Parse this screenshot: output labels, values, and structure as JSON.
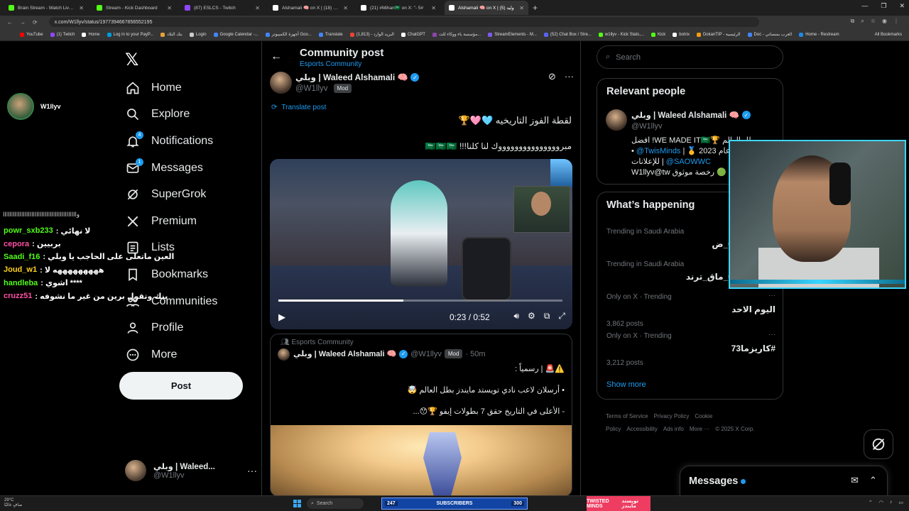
{
  "browser": {
    "tabs": [
      {
        "label": "Brain Stream - Watch Live on K",
        "color": "#53fc18",
        "active": false
      },
      {
        "label": "Stream - Kick Dashboard",
        "color": "#53fc18",
        "active": false
      },
      {
        "label": "(87) ESLCS - Twitch",
        "color": "#9146ff",
        "active": false
      },
      {
        "label": "Alshamali 🧠 on X | وليد (18)",
        "color": "#ffffff",
        "active": false
      },
      {
        "label": "(21) #Mihan🇸🇦 on X: \"- 5#",
        "color": "#ffffff",
        "active": false
      },
      {
        "label": "Alshamali 🧠 on X | وليد (5)",
        "color": "#ffffff",
        "active": true
      }
    ],
    "url": "x.com/W1llyv/status/1977394667856552195",
    "bookmarks": [
      {
        "label": "YouTube",
        "color": "#ff0000"
      },
      {
        "label": "(1) Twitch",
        "color": "#9146ff"
      },
      {
        "label": "Home",
        "color": "#ffffff"
      },
      {
        "label": "Log in to your PayP...",
        "color": "#009cde"
      },
      {
        "label": "بنك البلاد",
        "color": "#e8a13a"
      },
      {
        "label": "Login",
        "color": "#cccccc"
      },
      {
        "label": "Google Calendar -...",
        "color": "#4285f4"
      },
      {
        "label": "أجهزة الكمبيوتر Goo...",
        "color": "#4285f4"
      },
      {
        "label": "Translate",
        "color": "#4285f4"
      },
      {
        "label": "البريد الوارد - (1,813)",
        "color": "#ea4335"
      },
      {
        "label": "ChatGPT",
        "color": "#ffffff"
      },
      {
        "label": "مؤسسة باء ووكاء للت...",
        "color": "#8e44ad"
      },
      {
        "label": "StreamElements - M...",
        "color": "#7f5af0"
      },
      {
        "label": "(52) Chat Box / Stre...",
        "color": "#5865f2"
      },
      {
        "label": "w1llyv - Kick Stats,...",
        "color": "#53fc18"
      },
      {
        "label": "Kick",
        "color": "#53fc18"
      },
      {
        "label": "botrix",
        "color": "#ffffff"
      },
      {
        "label": "DokanTIP - الرئيسية",
        "color": "#f39c12"
      },
      {
        "label": "Doc - العرب بمنصاتي",
        "color": "#4285f4"
      },
      {
        "label": "Home - Restream",
        "color": "#1e88e5"
      }
    ],
    "all_bookmarks": "All Bookmarks"
  },
  "overlay": {
    "streamer_name": "W1llyv",
    "chat_scroll": "واااااااااااااااااااااااااااااااااااااااااااا",
    "chat": [
      {
        "user": "powr_sxb233",
        "message": ": لا نهائي",
        "color": "#53fc18"
      },
      {
        "user": "cepora",
        "message": ": بربيين",
        "color": "#ff4fa3"
      },
      {
        "user": "Saadi_f16",
        "message": ": العين ماتعلى على الحاجب يا وبلي",
        "color": "#53fc18"
      },
      {
        "user": "Joud_w1",
        "message": ": هههههههههه لا",
        "color": "#ffd21f"
      },
      {
        "user": "handleba",
        "message": ": اشوي ****",
        "color": "#53fc18"
      },
      {
        "user": "cruzz51",
        "message": ": ينك وتقول برين من غير ما نشوفه",
        "color": "#ff4fa3"
      }
    ]
  },
  "nav": {
    "items": [
      {
        "label": "Home",
        "icon": "home-icon"
      },
      {
        "label": "Explore",
        "icon": "search-icon"
      },
      {
        "label": "Notifications",
        "icon": "bell-icon",
        "badge": "4"
      },
      {
        "label": "Messages",
        "icon": "mail-icon",
        "badge": "1"
      },
      {
        "label": "SuperGrok",
        "icon": "grok-icon"
      },
      {
        "label": "Premium",
        "icon": "x-icon"
      },
      {
        "label": "Lists",
        "icon": "list-icon"
      },
      {
        "label": "Bookmarks",
        "icon": "bookmark-icon"
      },
      {
        "label": "Communities",
        "icon": "people-icon"
      },
      {
        "label": "Profile",
        "icon": "person-icon"
      },
      {
        "label": "More",
        "icon": "more-circle-icon"
      }
    ],
    "post_label": "Post",
    "account": {
      "name": "وبلي | Waleed...",
      "handle": "@W1llyv"
    }
  },
  "post": {
    "header_title": "Community post",
    "header_sub": "Esports Community",
    "author_name": "وبلي | Waleed Alshamali 🧠",
    "author_handle": "@W1llyv",
    "mod_label": "Mod",
    "translate": "Translate post",
    "text1": "لقطة الفوز التاريخيه 🩵🩷🏆",
    "text2": "مبروووووووووووووووك لنا كلنا!!! 🇸🇦🇸🇦🇸🇦",
    "video": {
      "time": "0:23 / 0:52",
      "progress": 0.44
    },
    "quote": {
      "community": "Esports Community",
      "name": "وبلي | Waleed Alshamali 🧠",
      "handle": "@W1llyv",
      "mod": "Mod",
      "time": "· 50m",
      "line1": "⚠️🚨 | رسمياً :",
      "line2": "• أرسلان لاعب نادي تويستد مايندز بطل العالم 🤯",
      "line3": "- الأعلى في التاريخ حقق 7 بطولات إيفو 🏆😯..."
    }
  },
  "right": {
    "search_placeholder": "Search",
    "relevant_title": "Relevant people",
    "rp_name": "وبلي | Waleed Alshamali 🧠",
    "rp_handle": "@W1llyv",
    "rp_bio1": "افضل !WE MADE IT🇸🇦🏆 بطل العالم",
    "rp_bio2_link": "@TwisMinds",
    "rp_bio2": " | 🥇 2023 عام",
    "rp_bio3": "للإعلانات | ",
    "rp_bio3_link": "@SAOWWC",
    "rp_bio4": "W1llyv@tw رخصة موثوق 🟢",
    "happening_title": "What’s happening",
    "trends": [
      {
        "context": "Trending in Saudi Arabia",
        "name": "0530270383_ض",
        "posts": ""
      },
      {
        "context": "Trending in Saudi Arabia",
        "name": "0563268679_ماق_ترند",
        "posts": ""
      },
      {
        "context": "Only on X · Trending",
        "name": "اليوم الاحد",
        "posts": "3,862 posts"
      },
      {
        "context": "Only on X · Trending",
        "name": "#كاريزما73",
        "posts": "3,212 posts"
      }
    ],
    "show_more": "Show more",
    "footer": [
      "Terms of Service",
      "Privacy Policy",
      "Cookie Policy",
      "Accessibility",
      "Ads info",
      "More ···",
      "© 2025 X Corp."
    ],
    "messages": "Messages"
  },
  "taskbar": {
    "temp": "29°C",
    "weather": "صافٍ غالبًا",
    "search": "Search",
    "subs_label": "SUBSCRIBERS",
    "subs_count": "247",
    "subs_goal": "300",
    "team_en": "TWISTED MINDS",
    "team_ar": "تويستد مايندز"
  }
}
